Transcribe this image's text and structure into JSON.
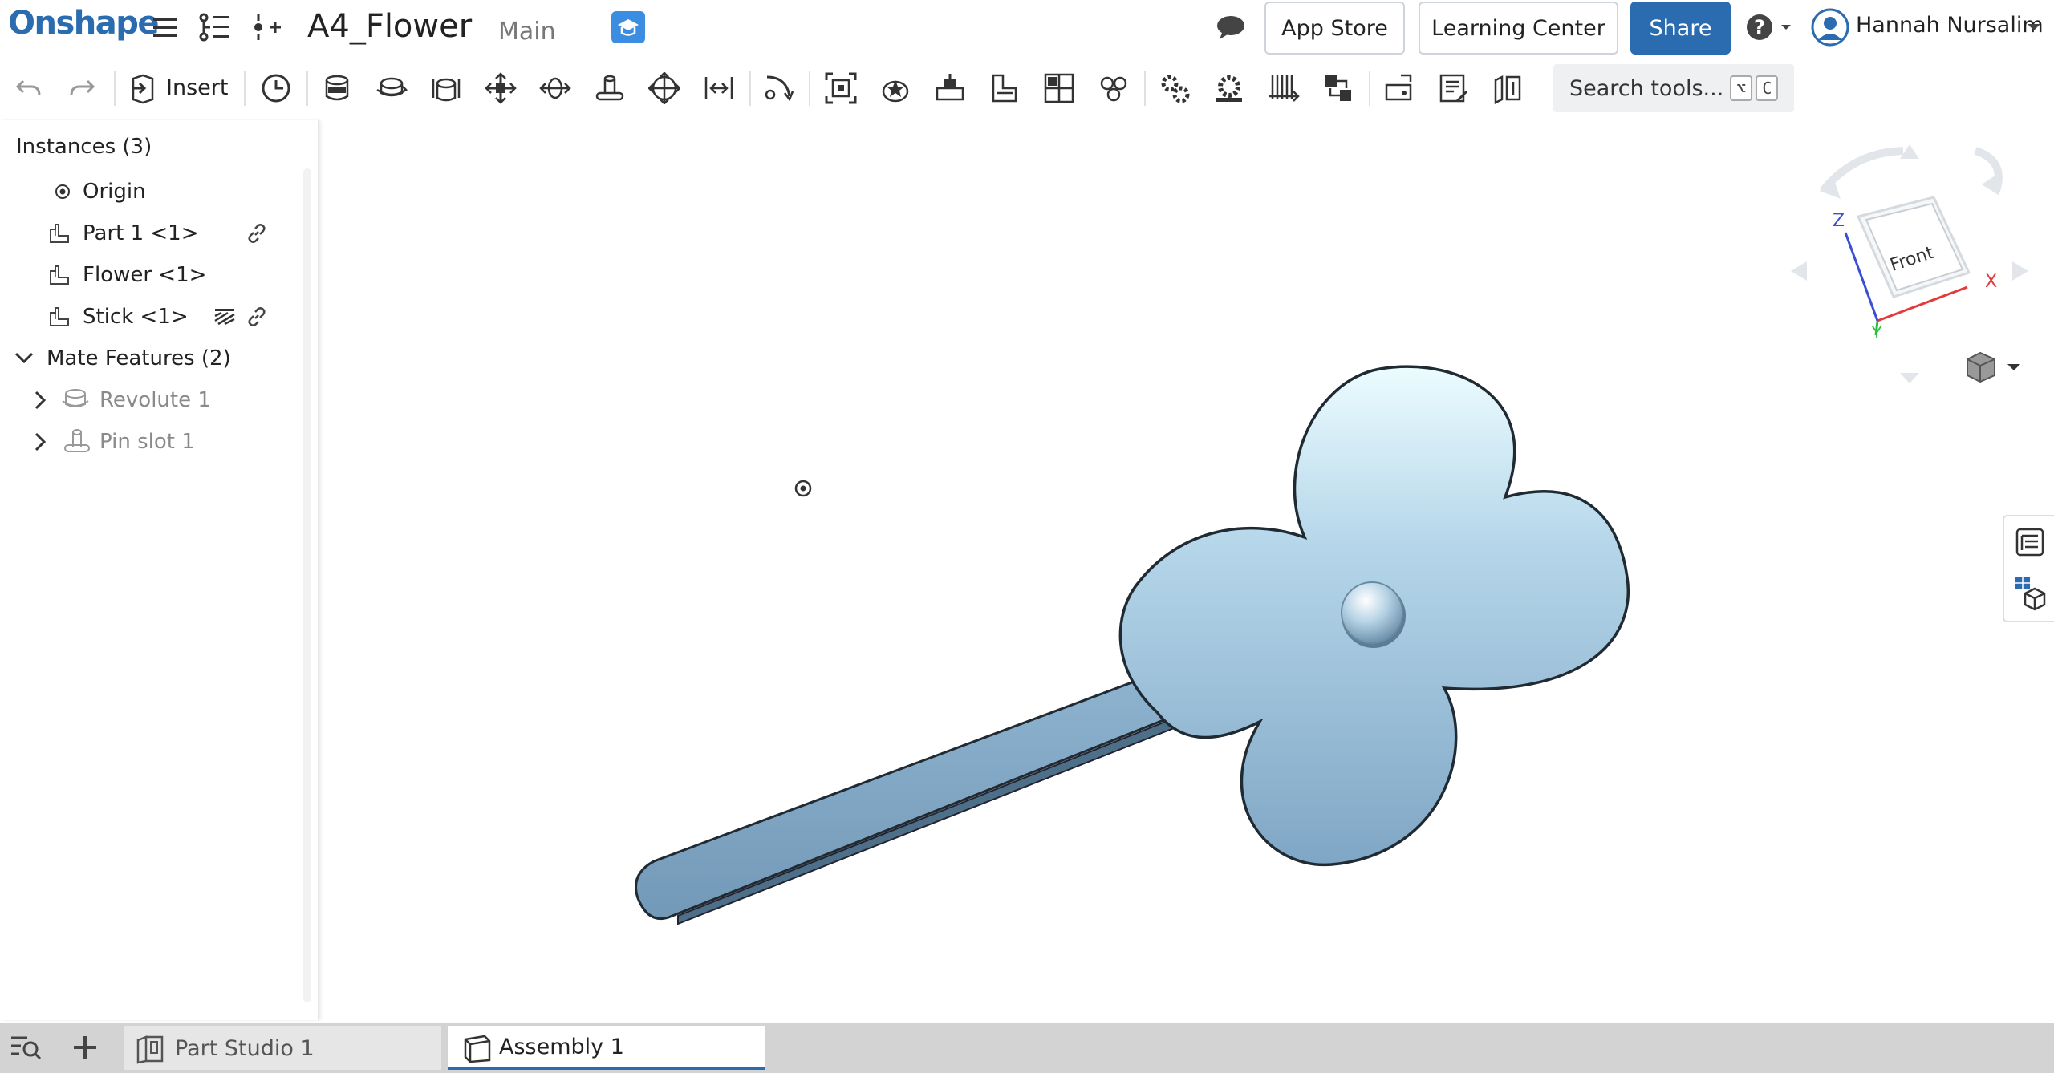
{
  "app": {
    "brand": "Onshape",
    "doc_title": "A4_Flower",
    "branch": "Main"
  },
  "header": {
    "app_store": "App Store",
    "learning_center": "Learning Center",
    "share": "Share",
    "user_name": "Hannah Nursalim"
  },
  "toolbar": {
    "insert": "Insert",
    "search_placeholder": "Search tools...",
    "search_shortcut_1": "⌥",
    "search_shortcut_2": "C"
  },
  "instances_panel": {
    "header": "Instances (3)",
    "items": [
      {
        "label": "Origin",
        "icon": "origin-icon"
      },
      {
        "label": "Part 1 <1>",
        "icon": "part-instance-icon",
        "link": true
      },
      {
        "label": "Flower <1>",
        "icon": "part-instance-icon"
      },
      {
        "label": "Stick <1>",
        "icon": "part-instance-icon",
        "link": true,
        "hatch": true
      }
    ],
    "mate_features": {
      "label": "Mate Features (2)",
      "items": [
        {
          "label": "Revolute 1",
          "icon": "revolute-mate-icon"
        },
        {
          "label": "Pin slot 1",
          "icon": "pin-slot-mate-icon"
        }
      ]
    }
  },
  "view_cube": {
    "face": "Front",
    "axes": [
      "X",
      "Y",
      "Z"
    ]
  },
  "tabs": [
    {
      "label": "Part Studio 1",
      "active": false
    },
    {
      "label": "Assembly 1",
      "active": true
    }
  ],
  "colors": {
    "brand_blue": "#2b6cb0",
    "part_blue": "#8fb5d0"
  }
}
